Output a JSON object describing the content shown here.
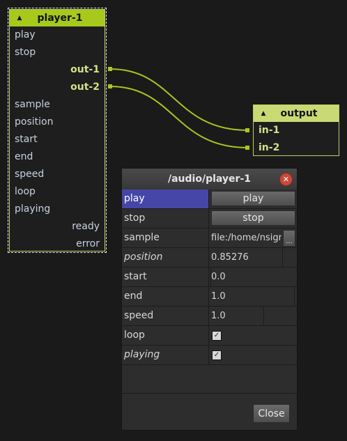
{
  "player_node": {
    "title": "player-1",
    "inputs": [
      "play",
      "stop"
    ],
    "outputs_top": [
      "out-1",
      "out-2"
    ],
    "controls": [
      "sample",
      "position",
      "start",
      "end",
      "speed",
      "loop",
      "playing"
    ],
    "status_outputs": [
      "ready",
      "error"
    ]
  },
  "output_node": {
    "title": "output",
    "inputs": [
      "in-1",
      "in-2"
    ]
  },
  "dialog": {
    "title": "/audio/player-1",
    "close_label": "Close",
    "rows": {
      "play": {
        "label": "play",
        "button": "play"
      },
      "stop": {
        "label": "stop",
        "button": "stop"
      },
      "sample": {
        "label": "sample",
        "value": "file:/home/nsigma/",
        "browse": "..."
      },
      "position": {
        "label": "position",
        "value": "0.85276"
      },
      "start": {
        "label": "start",
        "value": "0.0"
      },
      "end": {
        "label": "end",
        "value": "1.0"
      },
      "speed": {
        "label": "speed",
        "value": "1.0"
      },
      "loop": {
        "label": "loop",
        "checked": true
      },
      "playing": {
        "label": "playing",
        "checked": true
      }
    }
  },
  "colors": {
    "node_header": "#a6c91c",
    "wire": "#a6c91c",
    "selection": "#4646a8",
    "close_button": "#c84a3a"
  },
  "icons": {
    "collapse": "triangle-up-icon",
    "checkbox": "check-icon"
  }
}
